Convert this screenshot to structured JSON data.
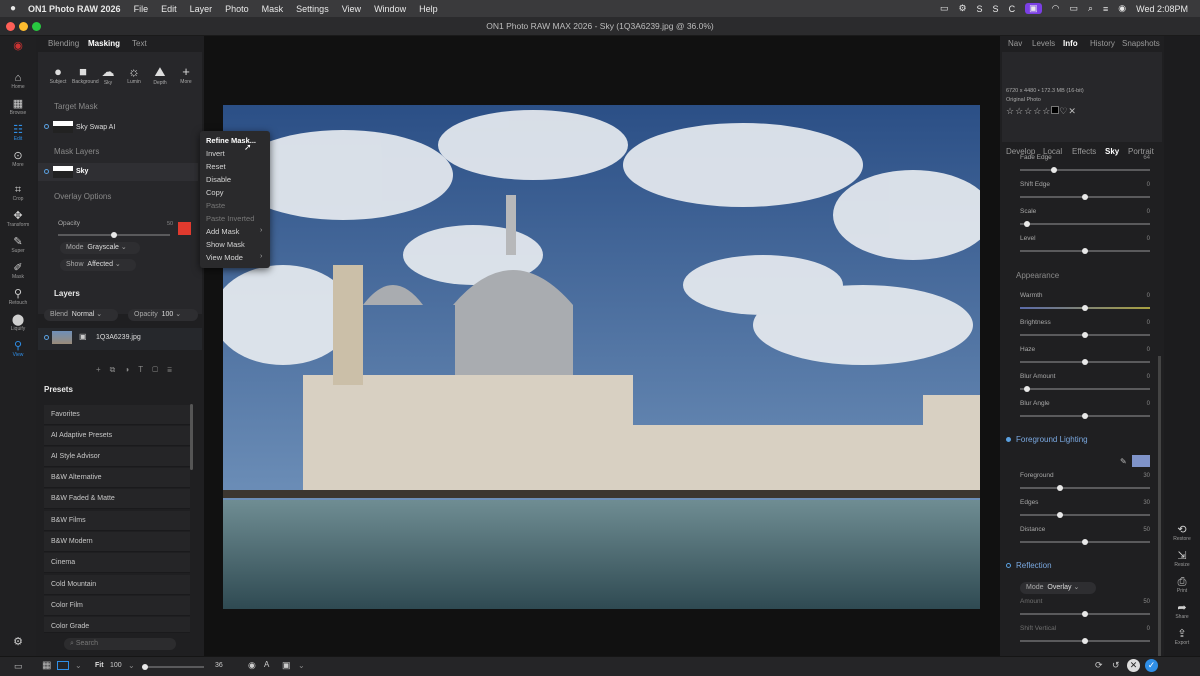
{
  "menubar": {
    "app": "ON1 Photo RAW 2026",
    "items": [
      "File",
      "Edit",
      "Layer",
      "Photo",
      "Mask",
      "Settings",
      "View",
      "Window",
      "Help"
    ],
    "clock": "Wed 2:08PM"
  },
  "window": {
    "title": "ON1 Photo RAW MAX 2026 - Sky (1Q3A6239.jpg @ 36.0%)"
  },
  "tools": [
    {
      "label": "Home",
      "icon": "home-icon"
    },
    {
      "label": "Browse",
      "icon": "grid-icon"
    },
    {
      "label": "Edit",
      "icon": "sliders-icon"
    },
    {
      "label": "More",
      "icon": "more-icon"
    },
    {
      "label": "Crop",
      "icon": "crop-icon"
    },
    {
      "label": "Transform",
      "icon": "transform-icon"
    },
    {
      "label": "Super",
      "icon": "super-icon"
    },
    {
      "label": "Mask",
      "icon": "mask-icon"
    },
    {
      "label": "Retouch",
      "icon": "retouch-icon"
    },
    {
      "label": "Liquify",
      "icon": "liquify-icon"
    },
    {
      "label": "View",
      "icon": "view-icon"
    }
  ],
  "left": {
    "tabs": [
      "Blending",
      "Masking",
      "Text"
    ],
    "maskTypes": [
      {
        "label": "Subject"
      },
      {
        "label": "Background"
      },
      {
        "label": "Sky"
      },
      {
        "label": "Lumin"
      },
      {
        "label": "Depth"
      },
      {
        "label": "More"
      }
    ],
    "targetMask": "Target Mask",
    "targetItem": "Sky Swap AI",
    "maskLayers": "Mask Layers",
    "maskLayerItem": "Sky",
    "overlayOptions": "Overlay Options",
    "opacityLabel": "Opacity",
    "opacityValue": "50",
    "opacityFraction": 0.5,
    "modeLabel": "Mode",
    "modeValue": "Grayscale",
    "showLabel": "Show",
    "showValue": "Affected",
    "layersTitle": "Layers",
    "blendLabel": "Blend",
    "blendValue": "Normal",
    "layerOpacityLabel": "Opacity",
    "layerOpacityValue": "100",
    "layerName": "1Q3A6239.jpg",
    "presetsTitle": "Presets",
    "presets": [
      "Favorites",
      "AI Adaptive Presets",
      "AI Style Advisor",
      "B&W Alternative",
      "B&W Faded & Matte",
      "B&W Films",
      "B&W Modern",
      "Cinema",
      "Cold Mountain",
      "Color Film",
      "Color Grade"
    ],
    "searchPlaceholder": "Search"
  },
  "context": {
    "items": [
      "Refine Mask...",
      "Invert",
      "Reset",
      "Disable",
      "Copy",
      "Paste",
      "Paste Inverted",
      "Add Mask",
      "Show Mask",
      "View Mode"
    ],
    "disabled": [
      "Paste",
      "Paste Inverted"
    ]
  },
  "right": {
    "tabsTop": [
      "Nav",
      "Levels",
      "Info",
      "History",
      "Snapshots"
    ],
    "info": "6720 x 4480 • 172.3 MB (16-bit)",
    "infoSub": "Original Photo",
    "tabsMid": [
      "Develop",
      "Local",
      "Effects",
      "Sky",
      "Portrait"
    ],
    "sliders": [
      {
        "label": "Fade Edge",
        "value": "64",
        "pos": 0.25
      },
      {
        "label": "Shift Edge",
        "value": "0",
        "pos": 0.5
      },
      {
        "label": "Scale",
        "value": "0",
        "pos": 0.03
      },
      {
        "label": "Level",
        "value": "0",
        "pos": 0.5
      }
    ],
    "appearance": "Appearance",
    "appSliders": [
      {
        "label": "Warmth",
        "value": "0",
        "pos": 0.5
      },
      {
        "label": "Brightness",
        "value": "0",
        "pos": 0.5
      },
      {
        "label": "Haze",
        "value": "0",
        "pos": 0.5
      },
      {
        "label": "Blur Amount",
        "value": "0",
        "pos": 0.03
      },
      {
        "label": "Blur Angle",
        "value": "0",
        "pos": 0.5
      }
    ],
    "foreground": "Foreground Lighting",
    "fgSliders": [
      {
        "label": "Foreground",
        "value": "30",
        "pos": 0.3
      },
      {
        "label": "Edges",
        "value": "30",
        "pos": 0.3
      },
      {
        "label": "Distance",
        "value": "50",
        "pos": 0.5
      }
    ],
    "reflection": "Reflection",
    "reflModeLabel": "Mode",
    "reflModeValue": "Overlay",
    "reflSliders": [
      {
        "label": "Amount",
        "value": "50",
        "pos": 0.5
      },
      {
        "label": "Shift Vertical",
        "value": "0",
        "pos": 0.5
      }
    ]
  },
  "rightStrip": [
    {
      "label": "Restore"
    },
    {
      "label": "Resize"
    },
    {
      "label": "Print"
    },
    {
      "label": "Share"
    },
    {
      "label": "Export"
    }
  ],
  "bottom": {
    "fit": "Fit",
    "zoom100": "100",
    "zoomValue": "36"
  }
}
